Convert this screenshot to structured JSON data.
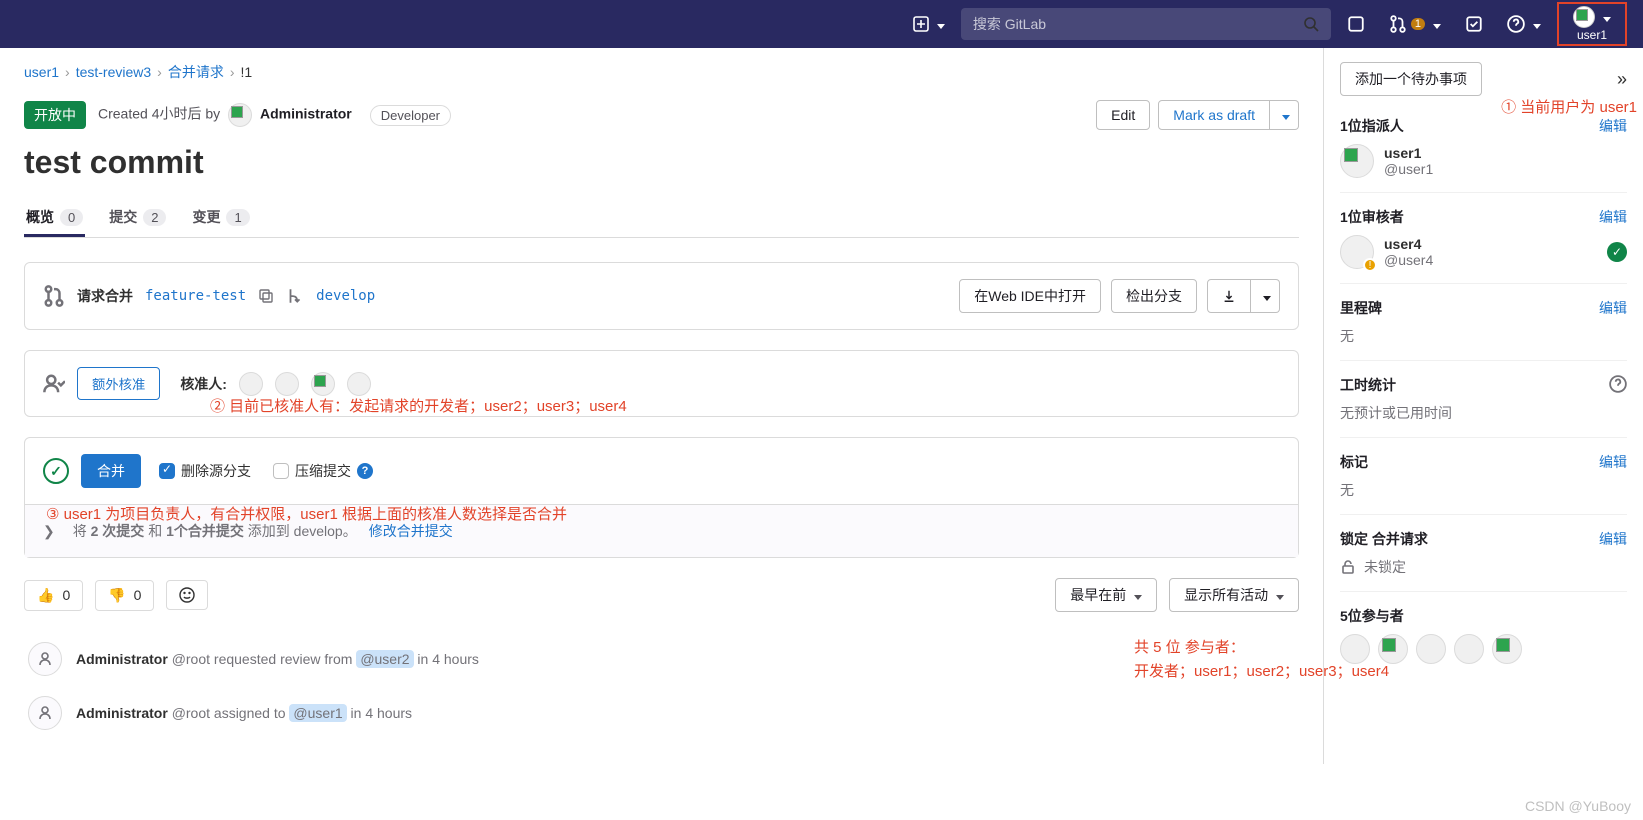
{
  "topnav": {
    "search_placeholder": "搜索 GitLab",
    "mr_badge": "1",
    "user": "user1"
  },
  "breadcrumbs": [
    "user1",
    "test-review3",
    "合并请求",
    "!1"
  ],
  "header": {
    "status": "开放中",
    "created": "Created 4小时后 by",
    "author": "Administrator",
    "role": "Developer",
    "edit": "Edit",
    "mark_draft": "Mark as draft"
  },
  "title": "test commit",
  "tabs": {
    "overview_label": "概览",
    "overview_count": "0",
    "commits_label": "提交",
    "commits_count": "2",
    "changes_label": "变更",
    "changes_count": "1"
  },
  "merge_widget": {
    "request_label": "请求合并",
    "source_branch": "feature-test",
    "target_branch": "develop",
    "open_ide": "在Web IDE中打开",
    "checkout": "检出分支"
  },
  "approval": {
    "extra": "额外核准",
    "approvers_label": "核准人:"
  },
  "merge_ready": {
    "merge_btn": "合并",
    "delete_src": "删除源分支",
    "squash": "压缩提交"
  },
  "commits_row": {
    "prefix": "将 ",
    "bold1": "2 次提交",
    "and": " 和 ",
    "bold2": "1个合并提交",
    "suffix": " 添加到 develop。",
    "edit_link": "修改合并提交"
  },
  "reactions": {
    "up": "0",
    "down": "0"
  },
  "sort": {
    "oldest": "最早在前",
    "all": "显示所有活动"
  },
  "timeline": [
    {
      "author": "Administrator",
      "action_pre": "@root requested review from ",
      "mention": "@user2",
      "action_post": " in 4 hours"
    },
    {
      "author": "Administrator",
      "action_pre": "@root assigned to ",
      "mention": "@user1",
      "action_post": " in 4 hours"
    }
  ],
  "sidebar": {
    "add_todo": "添加一个待办事项",
    "assignees": {
      "title": "1位指派人",
      "name": "user1",
      "handle": "@user1"
    },
    "reviewers": {
      "title": "1位审核者",
      "name": "user4",
      "handle": "@user4"
    },
    "milestone": {
      "title": "里程碑",
      "value": "无"
    },
    "time": {
      "title": "工时统计",
      "value": "无预计或已用时间"
    },
    "labels": {
      "title": "标记",
      "value": "无"
    },
    "lock": {
      "title": "锁定 合并请求",
      "value": "未锁定"
    },
    "participants": {
      "title": "5位参与者"
    },
    "edit": "编辑"
  },
  "annotations": {
    "a1": "① 当前用户为 user1",
    "a2": "② 目前已核准人有：发起请求的开发者；user2；user3；user4",
    "a3": "③ user1 为项目负责人，有合并权限，user1 根据上面的核准人数选择是否合并",
    "a4_l1": "共 5 位 参与者：",
    "a4_l2": "开发者；user1；user2；user3；user4"
  },
  "watermark": "CSDN @YuBooy"
}
